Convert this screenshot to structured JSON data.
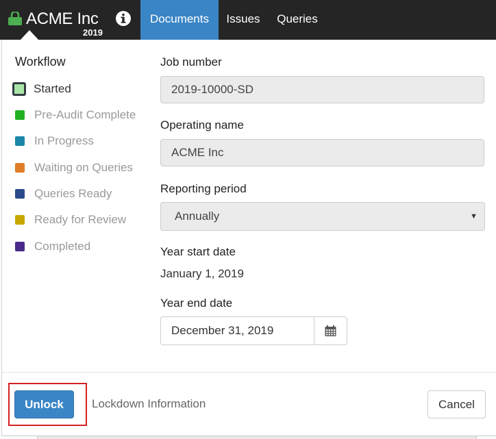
{
  "navbar": {
    "company": "ACME Inc",
    "year": "2019",
    "tabs": [
      {
        "label": "Documents",
        "active": true
      },
      {
        "label": "Issues",
        "active": false
      },
      {
        "label": "Queries",
        "active": false
      }
    ],
    "bg_color": "#252526",
    "active_color": "#3a85c6"
  },
  "workflow": {
    "title": "Workflow",
    "items": [
      {
        "label": "Started",
        "color": "#a8e6a8",
        "current": true
      },
      {
        "label": "Pre-Audit Complete",
        "color": "#22b022"
      },
      {
        "label": "In Progress",
        "color": "#1a86a8"
      },
      {
        "label": "Waiting on Queries",
        "color": "#e07f28"
      },
      {
        "label": "Queries Ready",
        "color": "#2a4a8a"
      },
      {
        "label": "Ready for Review",
        "color": "#c8a800"
      },
      {
        "label": "Completed",
        "color": "#4a2a8a"
      }
    ]
  },
  "form": {
    "job_number_label": "Job number",
    "job_number_value": "2019-10000-SD",
    "operating_name_label": "Operating name",
    "operating_name_value": "ACME Inc",
    "reporting_period_label": "Reporting period",
    "reporting_period_value": "Annually",
    "year_start_label": "Year start date",
    "year_start_value": "January 1, 2019",
    "year_end_label": "Year end date",
    "year_end_value": "December 31, 2019"
  },
  "footer": {
    "unlock_label": "Unlock",
    "lockdown_info_label": "Lockdown Information",
    "cancel_label": "Cancel"
  },
  "icons": {
    "lock": "lock-icon",
    "info": "info-icon",
    "calendar": "calendar-icon",
    "caret": "caret-down-icon"
  }
}
